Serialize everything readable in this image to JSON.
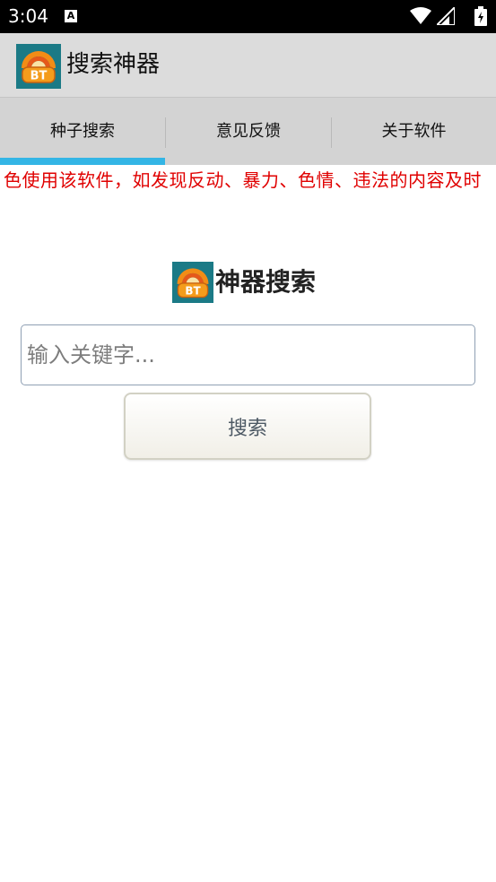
{
  "status_bar": {
    "time": "3:04",
    "notification_glyph": "A"
  },
  "app_bar": {
    "title": "搜索神器",
    "logo_text": "BT"
  },
  "tabs": [
    {
      "label": "种子搜索",
      "selected": true
    },
    {
      "label": "意见反馈",
      "selected": false
    },
    {
      "label": "关于软件",
      "selected": false
    }
  ],
  "marquee": {
    "text": "色使用该软件，如发现反动、暴力、色情、违法的内容及时"
  },
  "search": {
    "heading": "神器搜索",
    "logo_text": "BT",
    "placeholder": "输入关键字...",
    "value": "",
    "button_label": "搜索"
  },
  "colors": {
    "accent": "#33b5e5",
    "warning_text": "#e00000",
    "app_bar": "#dcdcdc",
    "tab_bar": "#d3d3d3"
  }
}
